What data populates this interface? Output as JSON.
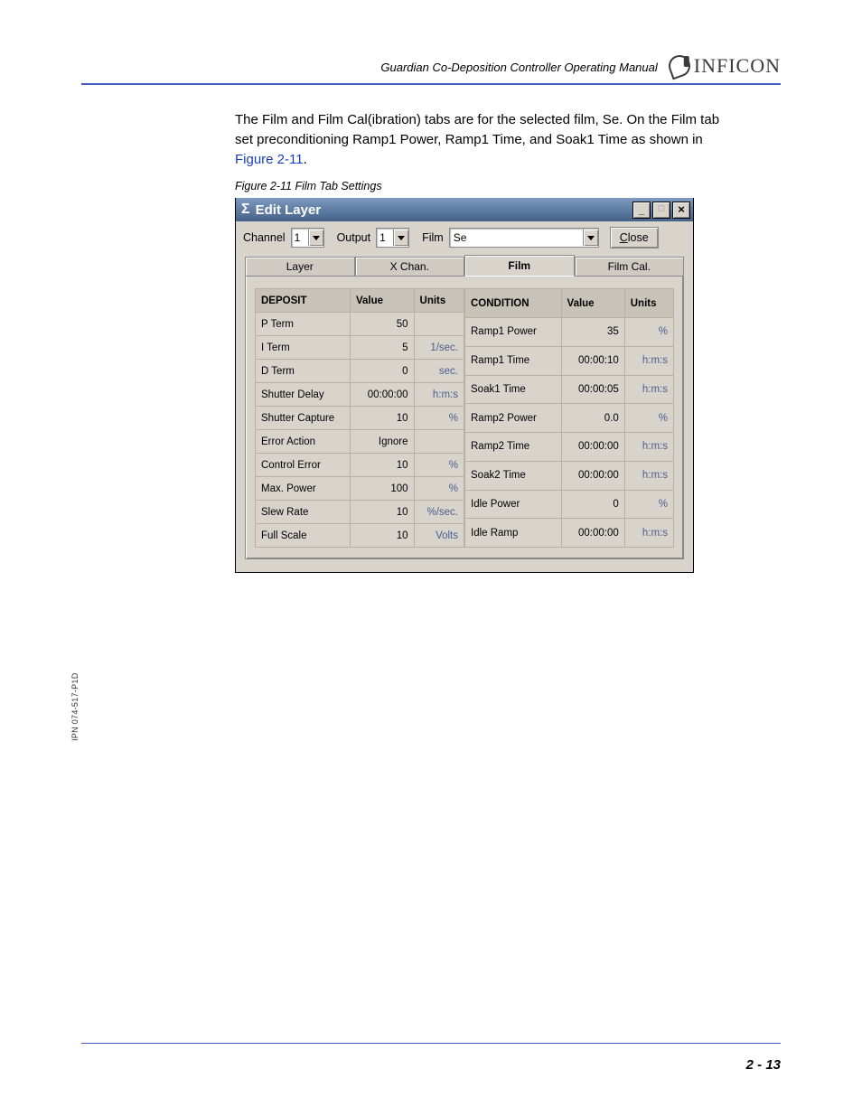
{
  "header": {
    "manual_title": "Guardian Co-Deposition Controller Operating Manual",
    "logo_text": "INFICON"
  },
  "paragraph": {
    "line1a": "The Film and Film Cal(ibration) tabs are for the selected film, Se. On the Film tab",
    "line2": "set preconditioning Ramp1 Power, Ramp1 Time, and Soak1 Time as shown in",
    "link": "Figure 2-11",
    "period": "."
  },
  "figure_caption": "Figure 2-11  Film Tab Settings",
  "window": {
    "sigma": "Σ",
    "title": "Edit Layer",
    "buttons": {
      "min": "_",
      "max": "□",
      "close": "×"
    },
    "toolbar": {
      "channel_label": "Channel",
      "channel_value": "1",
      "output_label": "Output",
      "output_value": "1",
      "film_label": "Film",
      "film_value": "Se",
      "close_btn_u": "C",
      "close_btn_rest": "lose"
    },
    "tabs": {
      "layer": "Layer",
      "xchan": "X Chan.",
      "film": "Film",
      "filmcal": "Film Cal."
    },
    "headers": {
      "value": "Value",
      "units": "Units"
    },
    "deposit": {
      "title": "DEPOSIT",
      "rows": [
        {
          "name": "P Term",
          "value": "50",
          "units": ""
        },
        {
          "name": "I Term",
          "value": "5",
          "units": "1/sec."
        },
        {
          "name": "D Term",
          "value": "0",
          "units": "sec."
        },
        {
          "name": "Shutter Delay",
          "value": "00:00:00",
          "units": "h:m:s"
        },
        {
          "name": "Shutter Capture",
          "value": "10",
          "units": "%"
        },
        {
          "name": "Error Action",
          "value": "Ignore",
          "units": ""
        },
        {
          "name": "Control Error",
          "value": "10",
          "units": "%"
        },
        {
          "name": "Max. Power",
          "value": "100",
          "units": "%"
        },
        {
          "name": "Slew Rate",
          "value": "10",
          "units": "%/sec."
        },
        {
          "name": "Full Scale",
          "value": "10",
          "units": "Volts"
        }
      ]
    },
    "condition": {
      "title": "CONDITION",
      "rows": [
        {
          "name": "Ramp1 Power",
          "value": "35",
          "units": "%"
        },
        {
          "name": "Ramp1 Time",
          "value": "00:00:10",
          "units": "h:m:s"
        },
        {
          "name": "Soak1 Time",
          "value": "00:00:05",
          "units": "h:m:s"
        },
        {
          "name": "Ramp2 Power",
          "value": "0.0",
          "units": "%"
        },
        {
          "name": "Ramp2 Time",
          "value": "00:00:00",
          "units": "h:m:s"
        },
        {
          "name": "Soak2 Time",
          "value": "00:00:00",
          "units": "h:m:s"
        },
        {
          "name": "Idle Power",
          "value": "0",
          "units": "%"
        },
        {
          "name": "Idle Ramp",
          "value": "00:00:00",
          "units": "h:m:s"
        }
      ]
    }
  },
  "side_note": "IPN 074-517-P1D",
  "page_number": "2 - 13"
}
